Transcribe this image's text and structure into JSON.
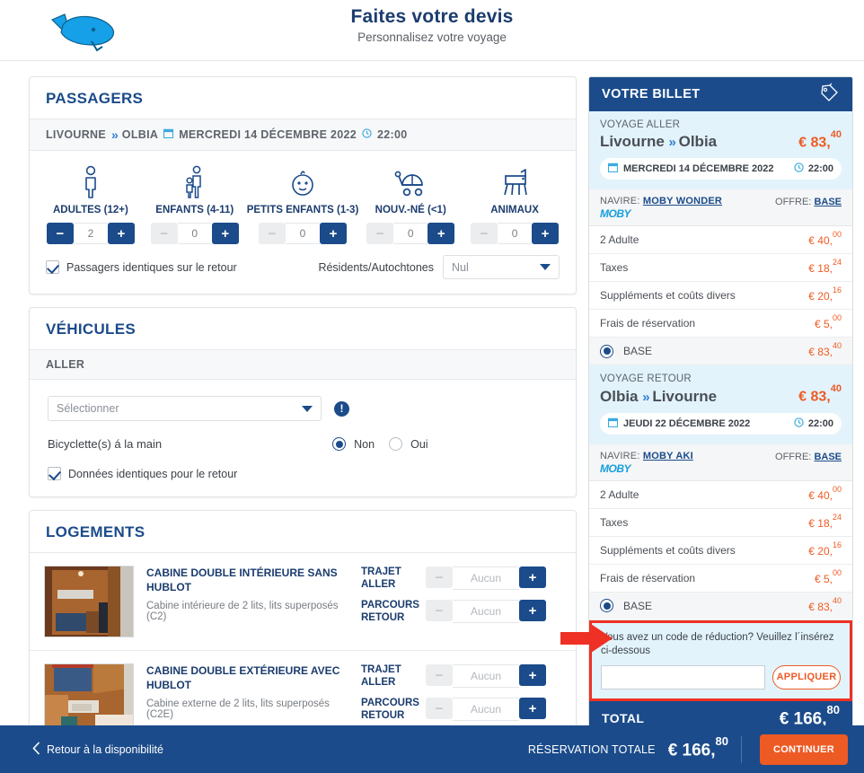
{
  "header": {
    "logo_icon": "whale-logo",
    "title": "Faites votre devis",
    "subtitle": "Personnalisez votre voyage"
  },
  "passengers": {
    "title": "PASSAGERS",
    "route": {
      "from": "LIVOURNE",
      "arrow": "»",
      "to": "OLBIA",
      "calendar_icon": "calendar-icon",
      "date": "MERCREDI 14 DÉCEMBRE 2022",
      "clock_icon": "clock-icon",
      "time": "22:00"
    },
    "types": [
      {
        "label": "ADULTES (12+)",
        "icon": "adult-icon",
        "value": "2",
        "minus_enabled": true,
        "plus_enabled": true
      },
      {
        "label": "ENFANTS (4-11)",
        "icon": "child-icon",
        "value": "0",
        "minus_enabled": false,
        "plus_enabled": true
      },
      {
        "label": "PETITS ENFANTS (1-3)",
        "icon": "toddler-icon",
        "value": "0",
        "minus_enabled": false,
        "plus_enabled": true
      },
      {
        "label": "NOUV.-NÉ (<1)",
        "icon": "stroller-icon",
        "value": "0",
        "minus_enabled": false,
        "plus_enabled": true
      },
      {
        "label": "ANIMAUX",
        "icon": "pet-icon",
        "value": "0",
        "minus_enabled": false,
        "plus_enabled": true
      }
    ],
    "same_return_label": "Passagers identiques sur le retour",
    "same_return_checked": true,
    "residents_label": "Résidents/Autochtones",
    "residents_value": "Nul",
    "minus_label": "−",
    "plus_label": "+"
  },
  "vehicles": {
    "title": "VÉHICULES",
    "leg_label": "ALLER",
    "select_placeholder": "Sélectionner",
    "warning_icon": "info-exclamation-icon",
    "bike_label": "Bicyclette(s) á la main",
    "bike_no": "Non",
    "bike_yes": "Oui",
    "bike_selected": "Non",
    "same_return_label": "Données identiques pour le retour",
    "same_return_checked": true
  },
  "accommodations": {
    "title": "LOGEMENTS",
    "minus_label": "−",
    "plus_label": "+",
    "rows": [
      {
        "thumb": "cabin-interior-photo",
        "name": "CABINE DOUBLE INTÉRIEURE SANS HUBLOT",
        "desc": "Cabine intérieure de 2 lits, lits superposés (C2)",
        "legs": [
          {
            "label": "TRAJET ALLER",
            "value": "Aucun"
          },
          {
            "label": "PARCOURS RETOUR",
            "value": "Aucun"
          }
        ]
      },
      {
        "thumb": "cabin-exterior-photo",
        "name": "CABINE DOUBLE EXTÉRIEURE AVEC HUBLOT",
        "desc": "Cabine externe de 2 lits, lits superposés (C2E)",
        "legs": [
          {
            "label": "TRAJET ALLER",
            "value": "Aucun"
          },
          {
            "label": "PARCOURS RETOUR",
            "value": "Aucun"
          }
        ]
      }
    ]
  },
  "ticket": {
    "header_title": "VOTRE BILLET",
    "header_icon": "tag-icon",
    "legs": [
      {
        "kind_label": "VOYAGE ALLER",
        "from": "Livourne",
        "arrow": "»",
        "to": "Olbia",
        "price_main": "€ 83,",
        "price_cents": "40",
        "calendar_icon": "calendar-icon",
        "date": "MERCREDI 14 DÉCEMBRE 2022",
        "clock_icon": "clock-icon",
        "time": "22:00",
        "ship_label": "NAVIRE:",
        "ship_name": "MOBY WONDER",
        "company_logo": "MOBY",
        "offer_label": "OFFRE:",
        "offer_value": "BASE",
        "lines": [
          {
            "label": "2 Adulte",
            "amount_main": "€ 40,",
            "amount_cents": "00"
          },
          {
            "label": "Taxes",
            "amount_main": "€ 18,",
            "amount_cents": "24"
          },
          {
            "label": "Suppléments et coûts divers",
            "amount_main": "€ 20,",
            "amount_cents": "16"
          },
          {
            "label": "Frais de réservation",
            "amount_main": "€ 5,",
            "amount_cents": "00"
          }
        ],
        "base_label": "BASE",
        "base_amount_main": "€ 83,",
        "base_amount_cents": "40",
        "base_selected": true
      },
      {
        "kind_label": "VOYAGE RETOUR",
        "from": "Olbia",
        "arrow": "»",
        "to": "Livourne",
        "price_main": "€ 83,",
        "price_cents": "40",
        "calendar_icon": "calendar-icon",
        "date": "JEUDI 22 DÉCEMBRE 2022",
        "clock_icon": "clock-icon",
        "time": "22:00",
        "ship_label": "NAVIRE:",
        "ship_name": "MOBY AKI",
        "company_logo": "MOBY",
        "offer_label": "OFFRE:",
        "offer_value": "BASE",
        "lines": [
          {
            "label": "2 Adulte",
            "amount_main": "€ 40,",
            "amount_cents": "00"
          },
          {
            "label": "Taxes",
            "amount_main": "€ 18,",
            "amount_cents": "24"
          },
          {
            "label": "Suppléments et coûts divers",
            "amount_main": "€ 20,",
            "amount_cents": "16"
          },
          {
            "label": "Frais de réservation",
            "amount_main": "€ 5,",
            "amount_cents": "00"
          }
        ],
        "base_label": "BASE",
        "base_amount_main": "€ 83,",
        "base_amount_cents": "40",
        "base_selected": true
      }
    ],
    "promo": {
      "text": "Vous avez un code de réduction? Veuillez l´insérez ci-dessous",
      "input_value": "",
      "button_label": "APPLIQUER",
      "highlight_color": "#ee3124"
    },
    "total_label": "TOTAL",
    "total_main": "€ 166,",
    "total_cents": "80"
  },
  "footer": {
    "back_icon": "chevron-left-icon",
    "back_label": "Retour à la disponibilité",
    "total_label": "RÉSERVATION TOTALE",
    "total_main": "€ 166,",
    "total_cents": "80",
    "continue_label": "CONTINUER"
  },
  "annotation": {
    "arrow_icon": "red-arrow-right",
    "color": "#ee3124"
  },
  "colors": {
    "brand_blue": "#1b4b8a",
    "accent_orange": "#ee5a24",
    "light_blue_panel": "#e2f3fc",
    "moby_cyan": "#169fdb"
  }
}
